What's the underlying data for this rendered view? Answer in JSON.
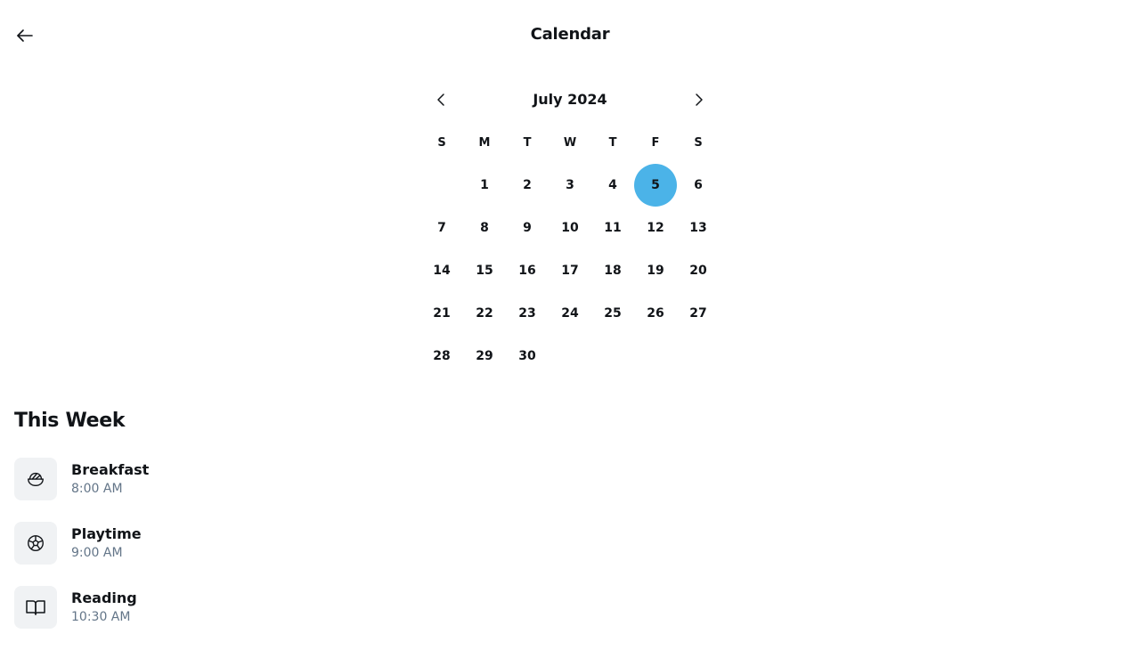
{
  "header": {
    "title": "Calendar",
    "back_icon": "arrow-left-icon"
  },
  "calendar": {
    "month_label": "July 2024",
    "prev_icon": "chevron-left-icon",
    "next_icon": "chevron-right-icon",
    "weekdays": [
      "S",
      "M",
      "T",
      "W",
      "T",
      "F",
      "S"
    ],
    "leading_blanks": 1,
    "days": [
      1,
      2,
      3,
      4,
      5,
      6,
      7,
      8,
      9,
      10,
      11,
      12,
      13,
      14,
      15,
      16,
      17,
      18,
      19,
      20,
      21,
      22,
      23,
      24,
      25,
      26,
      27,
      28,
      29,
      30
    ],
    "selected_day": 5,
    "selected_color": "#4bb3e8"
  },
  "section": {
    "title": "This Week"
  },
  "events": [
    {
      "name": "Breakfast",
      "time": "8:00 AM",
      "icon": "bowl-icon"
    },
    {
      "name": "Playtime",
      "time": "9:00 AM",
      "icon": "ball-icon"
    },
    {
      "name": "Reading",
      "time": "10:30 AM",
      "icon": "book-icon"
    }
  ]
}
